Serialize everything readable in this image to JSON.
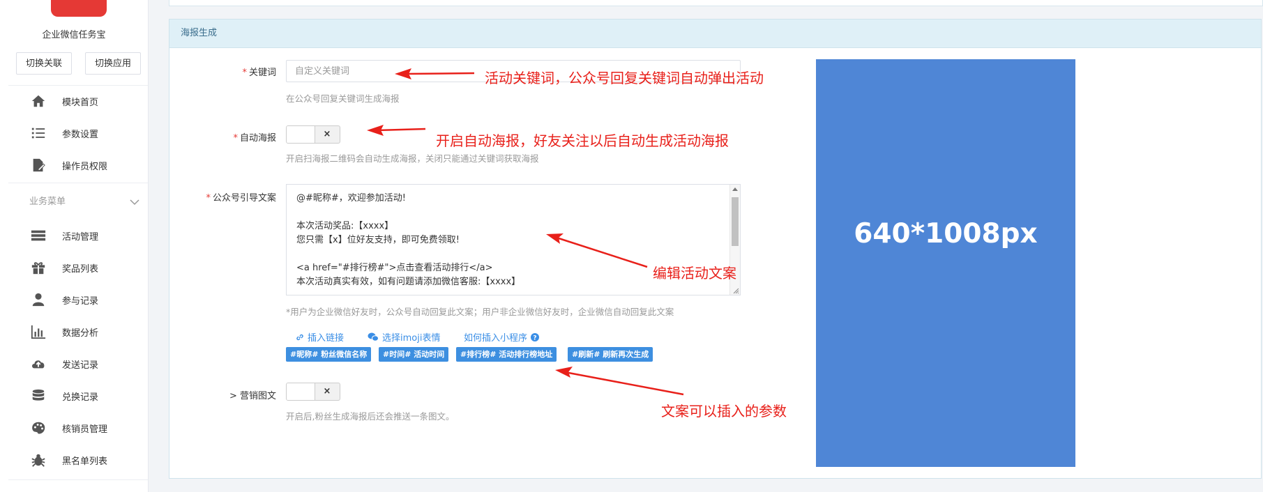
{
  "sidebar": {
    "app_name": "企业微信任务宝",
    "switch_relation": "切换关联",
    "switch_app": "切换应用",
    "top_items": [
      {
        "label": "模块首页",
        "icon": "home-icon"
      },
      {
        "label": "参数设置",
        "icon": "list-settings-icon"
      },
      {
        "label": "操作员权限",
        "icon": "document-edit-icon"
      }
    ],
    "group_label": "业务菜单",
    "group_items": [
      {
        "label": "活动管理",
        "icon": "server-icon"
      },
      {
        "label": "奖品列表",
        "icon": "gift-icon"
      },
      {
        "label": "参与记录",
        "icon": "user-icon"
      },
      {
        "label": "数据分析",
        "icon": "bar-chart-icon"
      },
      {
        "label": "发送记录",
        "icon": "cloud-upload-icon"
      },
      {
        "label": "兑换记录",
        "icon": "database-icon"
      },
      {
        "label": "核销员管理",
        "icon": "palette-icon"
      },
      {
        "label": "黑名单列表",
        "icon": "bug-icon"
      }
    ]
  },
  "panel": {
    "title": "海报生成",
    "keyword": {
      "required_mark": "*",
      "label": "关键词",
      "placeholder": "自定义关键词",
      "help": "在公众号回复关键词生成海报"
    },
    "auto_poster": {
      "required_mark": "*",
      "label": "自动海报",
      "toggle_off": "×",
      "help": "开启扫海报二维码会自动生成海报，关闭只能通过关键词获取海报"
    },
    "guide_text": {
      "required_mark": "*",
      "label": "公众号引导文案",
      "lines": [
        "@#昵称#，欢迎参加活动!",
        "",
        "本次活动奖品:【xxxx】",
        "您只需【x】位好友支持，即可免费领取!",
        "",
        "<a href=\"#排行榜#\">点击查看活动排行</a>",
        "本次活动真实有效，如有问题请添加微信客服:【xxxx】"
      ],
      "help": "*用户为企业微信好友时，公众号自动回复此文案；用户非企业微信好友时，企业微信自动回复此文案"
    },
    "links": {
      "insert_link": "插入链接",
      "emoji": "选择imoji表情",
      "mini_program": "如何插入小程序"
    },
    "tags": [
      "#昵称# 粉丝微信名称",
      "#时间# 活动时间",
      "#排行榜# 活动排行榜地址",
      "#刷新# 刷新再次生成"
    ],
    "marketing": {
      "label": "> 营销图文",
      "toggle_off": "×",
      "help": "开启后,粉丝生成海报后还会推送一条图文。"
    },
    "poster_size": "640*1008px"
  },
  "annotations": {
    "keyword": "活动关键词，公众号回复关键词自动弹出活动",
    "auto_poster": "开启自动海报，好友关注以后自动生成活动海报",
    "edit_text": "编辑活动文案",
    "params": "文案可以插入的参数"
  },
  "colors": {
    "accent": "#3a8ee6",
    "annotation": "#e8201a",
    "poster": "#4f86d6",
    "logo": "#e53935",
    "panel_header": "#dff0f7"
  }
}
